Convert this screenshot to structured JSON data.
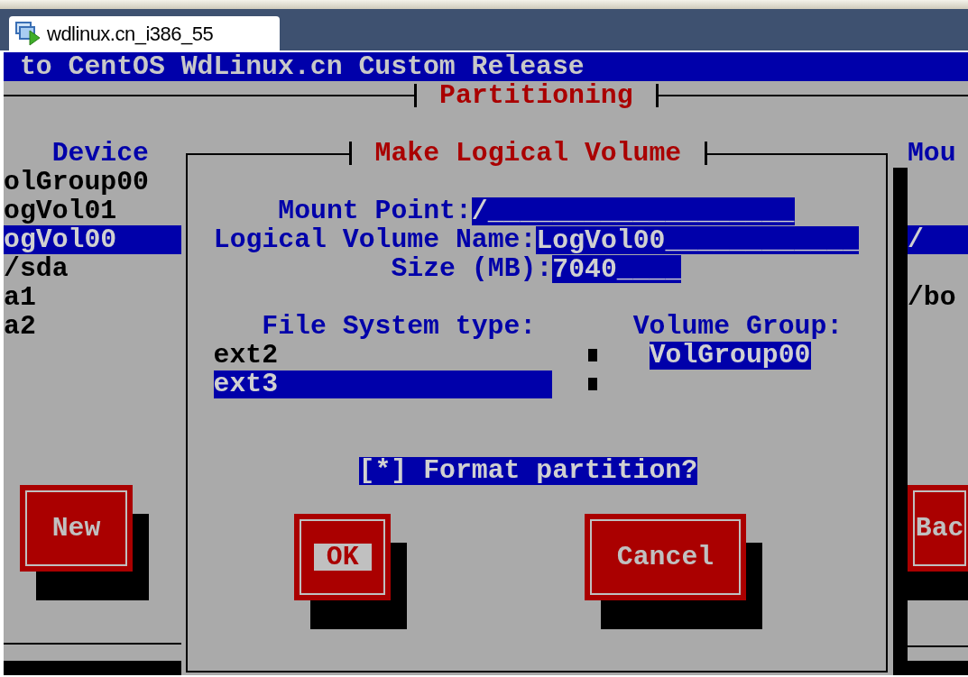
{
  "tab": {
    "title": "wdlinux.cn_i386_55",
    "selected": true
  },
  "banner": "to CentOS WdLinux.cn Custom Release",
  "partitioning": {
    "title": "Partitioning",
    "table": {
      "columns": [
        "Device",
        "Mou"
      ],
      "rows": [
        {
          "device": "olGroup00",
          "selected": false
        },
        {
          "device": "ogVol01",
          "selected": false
        },
        {
          "device": "ogVol00",
          "mount": "/",
          "selected": true
        },
        {
          "device": "/sda",
          "selected": false
        },
        {
          "device": "a1",
          "mount": "/bo",
          "selected": false
        },
        {
          "device": "a2",
          "selected": false
        }
      ]
    },
    "buttons": [
      {
        "label": "New"
      },
      {
        "label": "Bac"
      }
    ]
  },
  "dialog": {
    "title": "Make Logical Volume",
    "fields": [
      {
        "label": "Mount Point:",
        "value": "/___________________"
      },
      {
        "label": "Logical Volume Name:",
        "value": "LogVol00____________"
      },
      {
        "label": "Size (MB):",
        "value": "7040____"
      }
    ],
    "fs_type": {
      "label": "File System type:",
      "options": [
        {
          "label": "ext2",
          "selected": false
        },
        {
          "label": "ext3",
          "selected": true
        }
      ]
    },
    "volume_group": {
      "label": "Volume Group:",
      "options": [
        {
          "label": "VolGroup00",
          "selected": true
        }
      ]
    },
    "format": {
      "box": "[*]",
      "label": "Format partition?",
      "selected": true
    },
    "buttons": [
      {
        "label": "OK",
        "focused": true
      },
      {
        "label": "Cancel",
        "focused": false
      }
    ]
  }
}
